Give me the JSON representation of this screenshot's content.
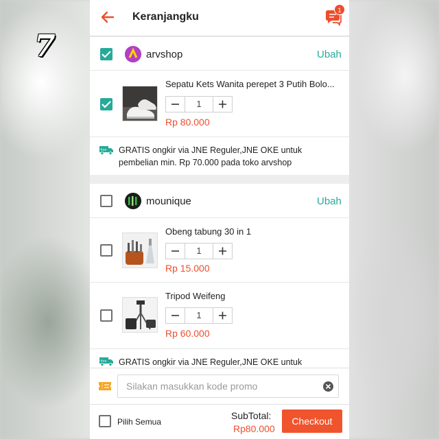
{
  "overlay_number": "7",
  "header": {
    "title": "Keranjangku",
    "chat_badge": "1"
  },
  "shops": [
    {
      "name": "arvshop",
      "checked": true,
      "edit_label": "Ubah",
      "items": [
        {
          "name": "Sepatu Kets Wanita perepet 3 Putih Bolo...",
          "qty": "1",
          "price": "Rp 80.000",
          "checked": true
        }
      ],
      "shipping": {
        "line1": "GRATIS ongkir via JNE Reguler,JNE OKE untuk",
        "line2": "pembelian min. Rp 70.000 pada toko arvshop"
      }
    },
    {
      "name": "mounique",
      "checked": false,
      "edit_label": "Ubah",
      "items": [
        {
          "name": "Obeng tabung 30 in 1",
          "qty": "1",
          "price": "Rp 15.000",
          "checked": false
        },
        {
          "name": "Tripod Weifeng",
          "qty": "1",
          "price": "Rp 60.000",
          "checked": false
        }
      ],
      "shipping": {
        "line1": "GRATIS ongkir via JNE Reguler,JNE OKE untuk"
      }
    }
  ],
  "promo": {
    "placeholder": "Silakan masukkan kode promo"
  },
  "footer": {
    "select_all_label": "Pilih Semua",
    "subtotal_label": "SubTotal:",
    "subtotal_value": "Rp80.000",
    "checkout_label": "Checkout"
  },
  "colors": {
    "accent_orange": "#ee4d2d",
    "teal": "#26aa99"
  }
}
